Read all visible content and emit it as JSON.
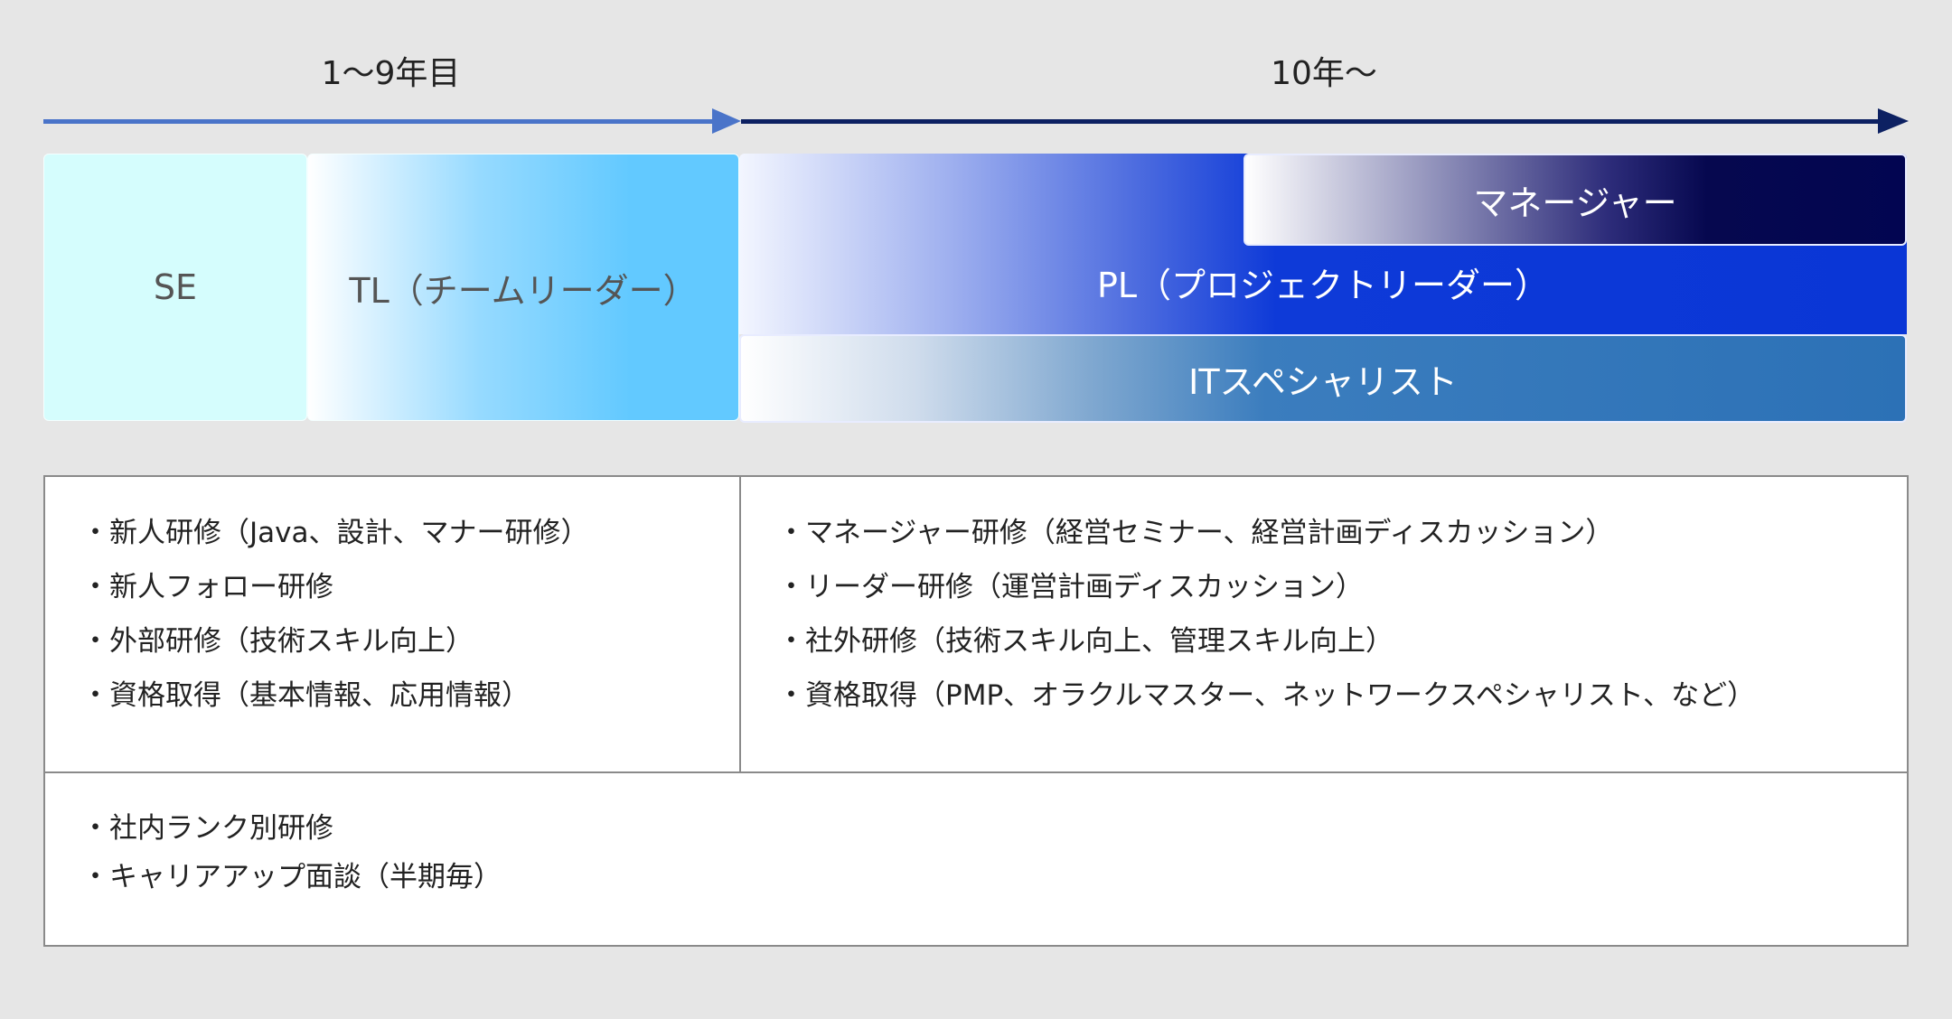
{
  "timeline": {
    "phase1_label": "1〜9年目",
    "phase2_label": "10年〜"
  },
  "roles": {
    "se": "SE",
    "tl": "TL（チームリーダー）",
    "pl": "PL（プロジェクトリーダー）",
    "manager": "マネージャー",
    "it_specialist": "ITスペシャリスト"
  },
  "training": {
    "early": [
      "・新人研修（Java、設計、マナー研修）",
      "・新人フォロー研修",
      "・外部研修（技術スキル向上）",
      "・資格取得（基本情報、応用情報）"
    ],
    "later": [
      "・マネージャー研修（経営セミナー、経営計画ディスカッション）",
      "・リーダー研修（運営計画ディスカッション）",
      "・社外研修（技術スキル向上、管理スキル向上）",
      "・資格取得（PMP、オラクルマスター、ネットワークスペシャリスト、など）"
    ],
    "common": [
      "・社内ランク別研修",
      "・キャリアアップ面談（半期毎）"
    ]
  },
  "colors": {
    "arrow_early": "#4a74c9",
    "arrow_later": "#0d2162",
    "se": "#d5fdfd",
    "tl": "#62c9ff",
    "pl": "#0a36d6",
    "manager": "#020551",
    "it_specialist": "#2c71b6"
  }
}
